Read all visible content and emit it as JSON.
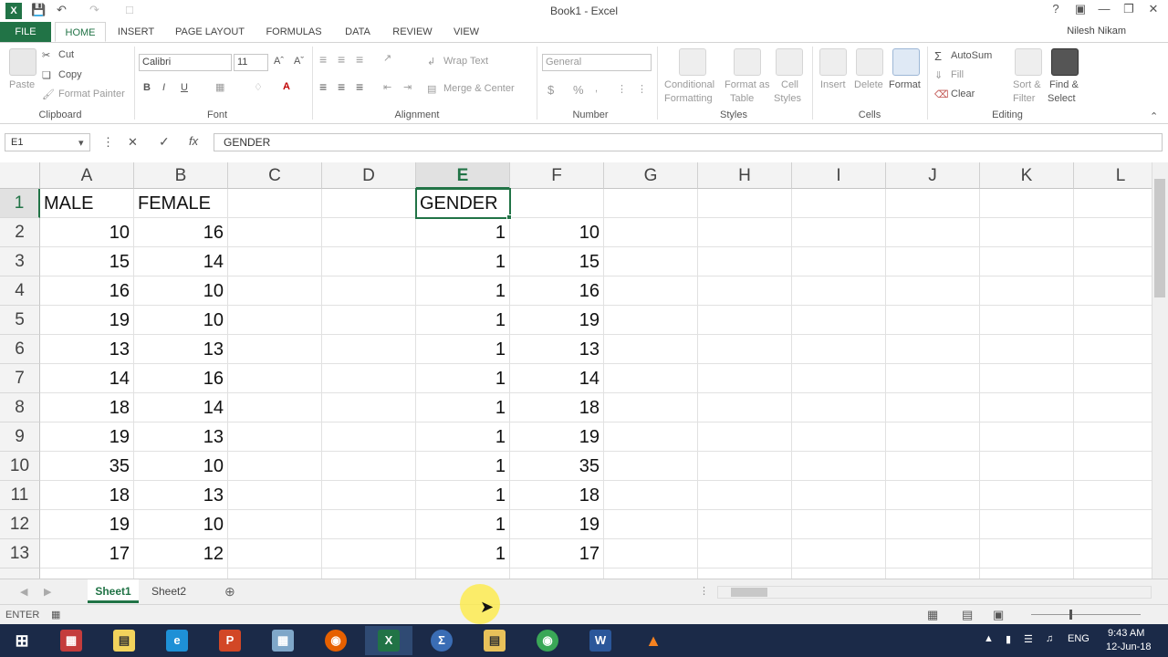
{
  "window": {
    "title": "Book1 - Excel",
    "user_name": "Nilesh Nikam"
  },
  "tabs": [
    "FILE",
    "HOME",
    "INSERT",
    "PAGE LAYOUT",
    "FORMULAS",
    "DATA",
    "REVIEW",
    "VIEW"
  ],
  "active_tab": "HOME",
  "ribbon": {
    "clipboard": {
      "label": "Clipboard",
      "paste": "Paste",
      "cut": "Cut",
      "copy": "Copy",
      "format_painter": "Format Painter"
    },
    "font": {
      "label": "Font",
      "name": "Calibri",
      "size": "11",
      "bold": "B",
      "italic": "I",
      "underline": "U"
    },
    "alignment": {
      "label": "Alignment",
      "wrap_text": "Wrap Text",
      "merge_center": "Merge & Center"
    },
    "number": {
      "label": "Number",
      "format": "General",
      "currency": "$",
      "percent": "%"
    },
    "styles": {
      "label": "Styles",
      "conditional": "Conditional",
      "conditional2": "Formatting",
      "format_as": "Format as",
      "format_as2": "Table",
      "cell": "Cell",
      "cell2": "Styles"
    },
    "cells": {
      "label": "Cells",
      "insert": "Insert",
      "delete": "Delete",
      "format": "Format"
    },
    "editing": {
      "label": "Editing",
      "autosum": "AutoSum",
      "fill": "Fill",
      "clear": "Clear",
      "sort": "Sort &",
      "sort2": "Filter",
      "find": "Find &",
      "find2": "Select"
    }
  },
  "formula_bar": {
    "name_box": "E1",
    "fx": "fx",
    "content": "GENDER"
  },
  "grid": {
    "columns": [
      "A",
      "B",
      "C",
      "D",
      "E",
      "F",
      "G",
      "H",
      "I",
      "J",
      "K",
      "L"
    ],
    "selected_column": "E",
    "rows": [
      {
        "n": "1",
        "A": "MALE",
        "B": "FEMALE",
        "E": "GENDER",
        "F": ""
      },
      {
        "n": "2",
        "A": "10",
        "B": "16",
        "E": "1",
        "F": "10"
      },
      {
        "n": "3",
        "A": "15",
        "B": "14",
        "E": "1",
        "F": "15"
      },
      {
        "n": "4",
        "A": "16",
        "B": "10",
        "E": "1",
        "F": "16"
      },
      {
        "n": "5",
        "A": "19",
        "B": "10",
        "E": "1",
        "F": "19"
      },
      {
        "n": "6",
        "A": "13",
        "B": "13",
        "E": "1",
        "F": "13"
      },
      {
        "n": "7",
        "A": "14",
        "B": "16",
        "E": "1",
        "F": "14"
      },
      {
        "n": "8",
        "A": "18",
        "B": "14",
        "E": "1",
        "F": "18"
      },
      {
        "n": "9",
        "A": "19",
        "B": "13",
        "E": "1",
        "F": "19"
      },
      {
        "n": "10",
        "A": "35",
        "B": "10",
        "E": "1",
        "F": "35"
      },
      {
        "n": "11",
        "A": "18",
        "B": "13",
        "E": "1",
        "F": "18"
      },
      {
        "n": "12",
        "A": "19",
        "B": "10",
        "E": "1",
        "F": "19"
      },
      {
        "n": "13",
        "A": "17",
        "B": "12",
        "E": "1",
        "F": "17"
      }
    ]
  },
  "sheets": [
    "Sheet1",
    "Sheet2"
  ],
  "active_sheet": "Sheet1",
  "status": {
    "mode": "ENTER"
  },
  "taskbar": {
    "apps": [
      "windows-logo",
      "archive-icon",
      "notepad-icon",
      "internet-explorer-icon",
      "powerpoint-icon",
      "calculator-icon",
      "firefox-icon",
      "excel-icon",
      "math-icon",
      "file-explorer-icon",
      "chrome-icon",
      "word-icon",
      "vlc-icon"
    ],
    "language": "ENG",
    "time": "9:43 AM",
    "date": "12-Jun-18"
  },
  "colors": {
    "excel_green": "#217346",
    "taskbar": "#1b2a48"
  }
}
